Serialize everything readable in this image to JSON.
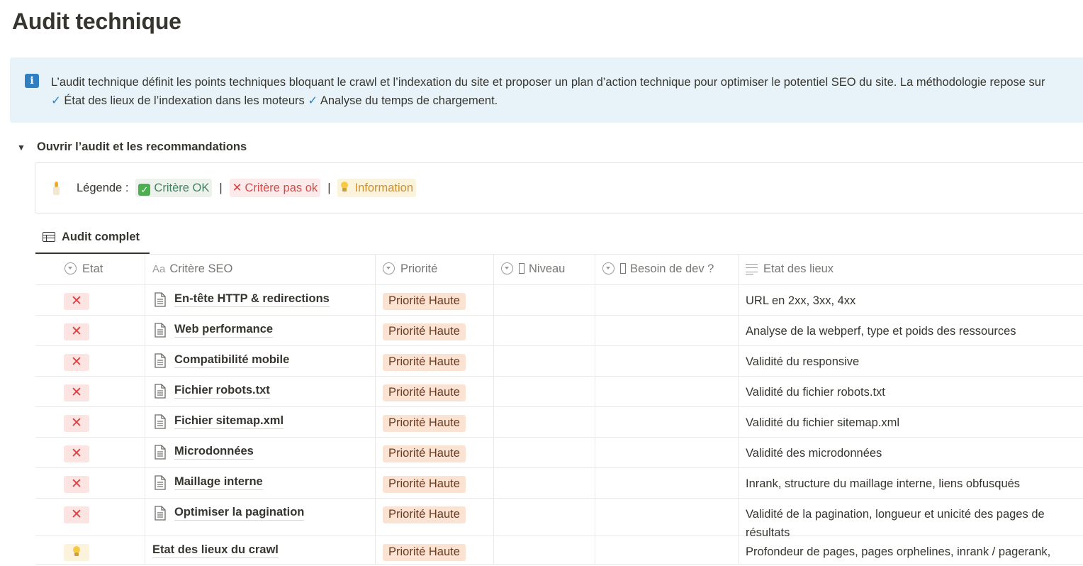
{
  "page": {
    "title": "Audit technique"
  },
  "callout": {
    "icon": "info-icon",
    "line1": "L’audit technique définit les points techniques bloquant le crawl et l’indexation du site et proposer un plan d’action technique pour optimiser le potentiel SEO du site. La méthodologie repose sur",
    "check1": "✓",
    "line2a": " État des lieux de l’indexation dans les moteurs ",
    "check2": "✓",
    "line2b": " Analyse du temps de chargement."
  },
  "toggle": {
    "arrow": "▼",
    "label": "Ouvrir l’audit et les recommandations"
  },
  "legend": {
    "label": "Légende :",
    "ok": "Critère OK",
    "ok_mark": "✓",
    "ko": "Critère pas ok",
    "ko_mark": "✕",
    "info": "Information",
    "sep": "|"
  },
  "view": {
    "tab_label": "Audit complet"
  },
  "table": {
    "columns": [
      "Etat",
      "Critère SEO",
      "Priorité",
      "Niveau",
      "Besoin de dev ?",
      "Etat des lieux"
    ],
    "aa": "Aa",
    "rows": [
      {
        "status": "ko",
        "status_mark": "✕",
        "criterion": "En-tête HTTP & redirections",
        "priority": "Priorité Haute",
        "desc": "URL en 2xx, 3xx, 4xx"
      },
      {
        "status": "ko",
        "status_mark": "✕",
        "criterion": "Web performance",
        "priority": "Priorité Haute",
        "desc": "Analyse de la webperf, type et poids des ressources"
      },
      {
        "status": "ko",
        "status_mark": "✕",
        "criterion": "Compatibilité mobile",
        "priority": "Priorité Haute",
        "desc": "Validité du responsive"
      },
      {
        "status": "ko",
        "status_mark": "✕",
        "criterion": "Fichier robots.txt",
        "priority": "Priorité Haute",
        "desc": "Validité du fichier robots.txt"
      },
      {
        "status": "ko",
        "status_mark": "✕",
        "criterion": "Fichier sitemap.xml",
        "priority": "Priorité Haute",
        "desc": "Validité du fichier sitemap.xml"
      },
      {
        "status": "ko",
        "status_mark": "✕",
        "criterion": "Microdonnées",
        "priority": "Priorité Haute",
        "desc": "Validité des microdonnées"
      },
      {
        "status": "ko",
        "status_mark": "✕",
        "criterion": "Maillage interne",
        "priority": "Priorité Haute",
        "desc": "Inrank, structure du maillage interne, liens obfusqués"
      },
      {
        "status": "ko",
        "status_mark": "✕",
        "criterion": "Optimiser la pagination",
        "priority": "Priorité Haute",
        "desc": "Validité de la pagination, longueur et unicité des pages de résultats"
      },
      {
        "status": "info",
        "status_mark": "",
        "criterion": "Etat des lieux du crawl",
        "priority": "Priorité Haute",
        "desc": "Profondeur de pages, pages orphelines, inrank / pagerank,"
      }
    ]
  },
  "colors": {
    "accent": "#2f7fc2",
    "danger": "#e03e3e",
    "priority_bg": "#fbe3d4",
    "callout_bg": "#e7f3f8"
  }
}
